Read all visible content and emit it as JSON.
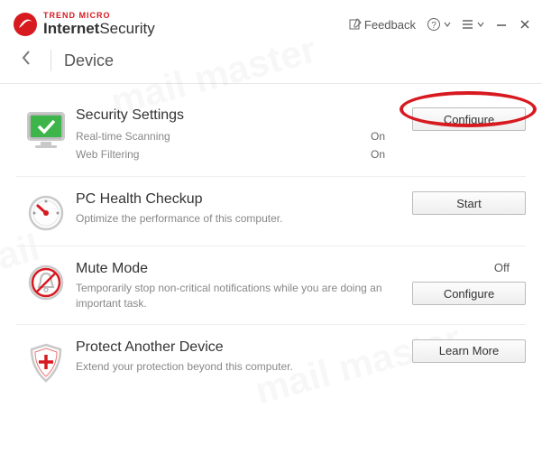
{
  "brand": {
    "company": "TREND MICRO",
    "product_bold": "Internet",
    "product_light": "Security"
  },
  "titlebar": {
    "feedback": "Feedback"
  },
  "page": {
    "title": "Device"
  },
  "sections": {
    "security": {
      "title": "Security Settings",
      "button": "Configure",
      "rows": [
        {
          "label": "Real-time Scanning",
          "value": "On"
        },
        {
          "label": "Web Filtering",
          "value": "On"
        }
      ]
    },
    "health": {
      "title": "PC Health Checkup",
      "desc": "Optimize the performance of this computer.",
      "button": "Start"
    },
    "mute": {
      "title": "Mute Mode",
      "status": "Off",
      "desc": "Temporarily stop non-critical notifications while you are doing an important task.",
      "button": "Configure"
    },
    "protect": {
      "title": "Protect Another Device",
      "desc": "Extend your protection beyond this computer.",
      "button": "Learn More"
    }
  }
}
